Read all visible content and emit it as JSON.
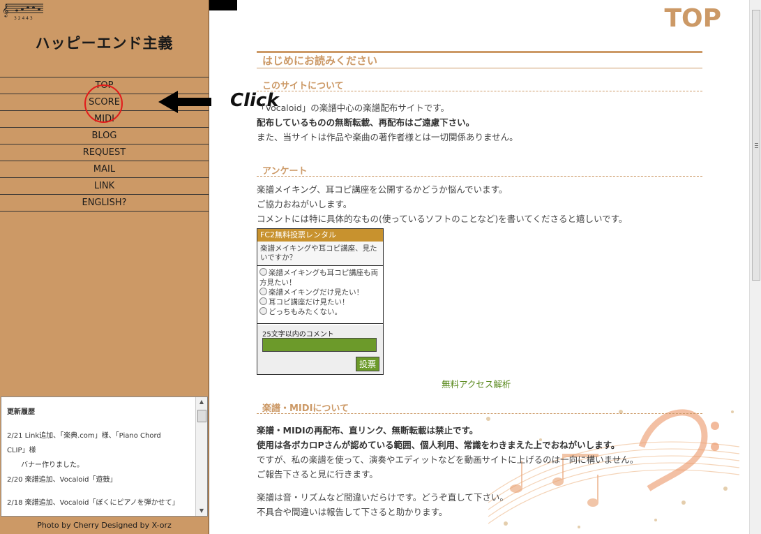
{
  "sidebar": {
    "site_title": "ハッピーエンド主義",
    "nav": [
      "TOP",
      "SCORE",
      "MIDI",
      "BLOG",
      "REQUEST",
      "MAIL",
      "LINK",
      "ENGLISH?"
    ],
    "logo_numbers": "3 2 4 4 3",
    "history_title": "更新履歴",
    "history": [
      "2/21 Link追加、「楽典.com」様、「Piano Chord",
      "CLIP」様",
      "　　バナー作りました。",
      "2/20 楽譜追加、Vocaloid「遊鼓」",
      "",
      "2/18 楽譜追加、Vocaloid「ぼくにピアノを弾かせて」"
    ],
    "credits": "Photo by Cherry Designed by X-orz"
  },
  "mini_tab": "",
  "annotation": {
    "label": "Click",
    "ring_color": "#e21b1b"
  },
  "main": {
    "page_heading": "TOP",
    "section_intro": "はじめにお読みください",
    "about_title": "このサイトについて",
    "about_lines": [
      "「Vocaloid」の楽譜中心の楽譜配布サイトです。",
      "配布しているものの無断転載、再配布はご遠慮下さい。",
      "また、当サイトは作品や楽曲の著作者様とは一切関係ありません。"
    ],
    "survey_title": "アンケート",
    "survey_lines": [
      "楽譜メイキング、耳コピ講座を公開するかどうか悩んでいます。",
      "ご協力おねがいします。",
      "コメントには特に具体的なもの(使っているソフトのことなど)を書いてくださると嬉しいです。"
    ],
    "poll": {
      "header": "FC2無料投票レンタル",
      "question": "楽譜メイキングや耳コピ講座、見たいですか？",
      "options": [
        "楽譜メイキングも耳コピ講座も両方見たい！",
        "楽譜メイキングだけ見たい！",
        "耳コピ講座だけ見たい！",
        "どっちもみたくない。"
      ],
      "comment_label": "25文字以内のコメント",
      "submit": "投票"
    },
    "analytics_link": "無料アクセス解析",
    "score_title": "楽譜・MIDIについて",
    "score_lines": [
      "楽譜・MIDIの再配布、直リンク、無断転載は禁止です。",
      "使用は各ボカロPさんが認めている範囲、個人利用、常識をわきまえた上でおねがいします。",
      "ですが、私の楽譜を使って、演奏やエディットなどを動画サイトに上げるのは一向に構いません。",
      "ご報告下さると見に行きます。",
      "楽譜は音・リズムなど間違いだらけです。どうぞ直して下さい。",
      "不具合や間違いは報告して下さると助かります。"
    ]
  },
  "colors": {
    "sidebar_bg": "#cc9966",
    "accent": "#cc9966",
    "link_green": "#5b8a1f"
  }
}
